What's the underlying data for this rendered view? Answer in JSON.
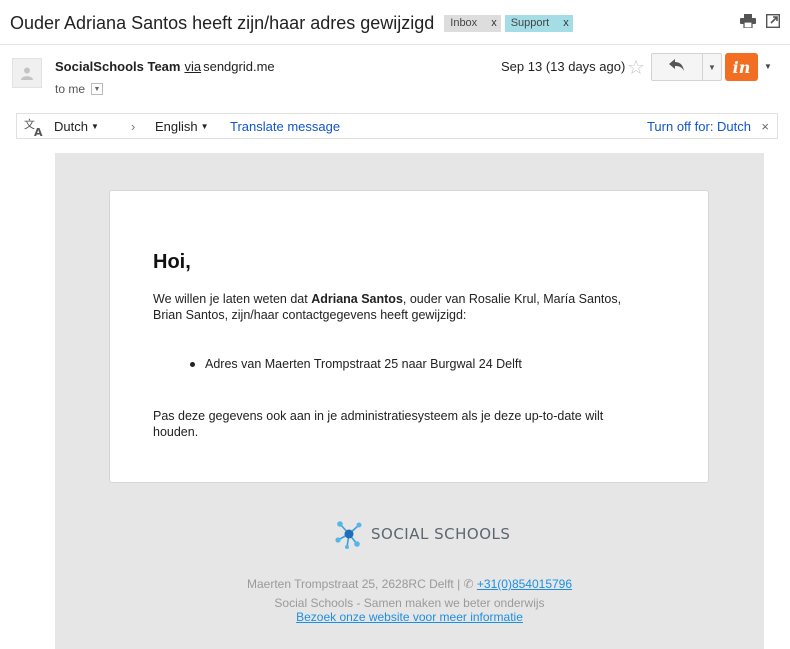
{
  "subject": "Ouder Adriana Santos heeft zijn/haar adres gewijzigd",
  "labels": [
    {
      "text": "Inbox",
      "close": "x",
      "color": "#dddddd"
    },
    {
      "text": "Support",
      "close": "x",
      "color": "#a4dde6"
    }
  ],
  "header_icons": [
    "print-icon",
    "new-window-icon"
  ],
  "sender": {
    "name": "SocialSchools Team",
    "via": "via",
    "domain": "sendgrid.me",
    "to": "to me",
    "date": "Sep 13 (13 days ago)"
  },
  "actions": {
    "reply_icon": "reply-icon",
    "star_icon": "star-icon",
    "invision_label": "in",
    "invision_color": "#f26e23"
  },
  "translate": {
    "from": "Dutch",
    "arrow": "›",
    "to": "English",
    "link": "Translate message",
    "turn_off": "Turn off for: Dutch",
    "close": "×"
  },
  "email": {
    "greeting": "Hoi,",
    "p1_before": "We willen je laten weten dat ",
    "p1_name": "Adriana Santos",
    "p1_after": ", ouder van Rosalie Krul, María Santos, Brian Santos, zijn/haar contactgegevens heeft gewijzigd:",
    "bullet": "Adres van Maerten Trompstraat 25 naar Burgwal 24 Delft",
    "p2": "Pas deze gegevens ook aan in je administratiesysteem als je deze up-to-date wilt houden."
  },
  "footer": {
    "logo_text": "SOCIAL SCHOOLS",
    "address": "Maerten Trompstraat 25, 2628RC Delft | ✆ ",
    "phone": "+31(0)854015796",
    "tagline": "Social Schools - Samen maken we beter onderwijs",
    "website_link": "Bezoek onze website voor meer informatie"
  }
}
